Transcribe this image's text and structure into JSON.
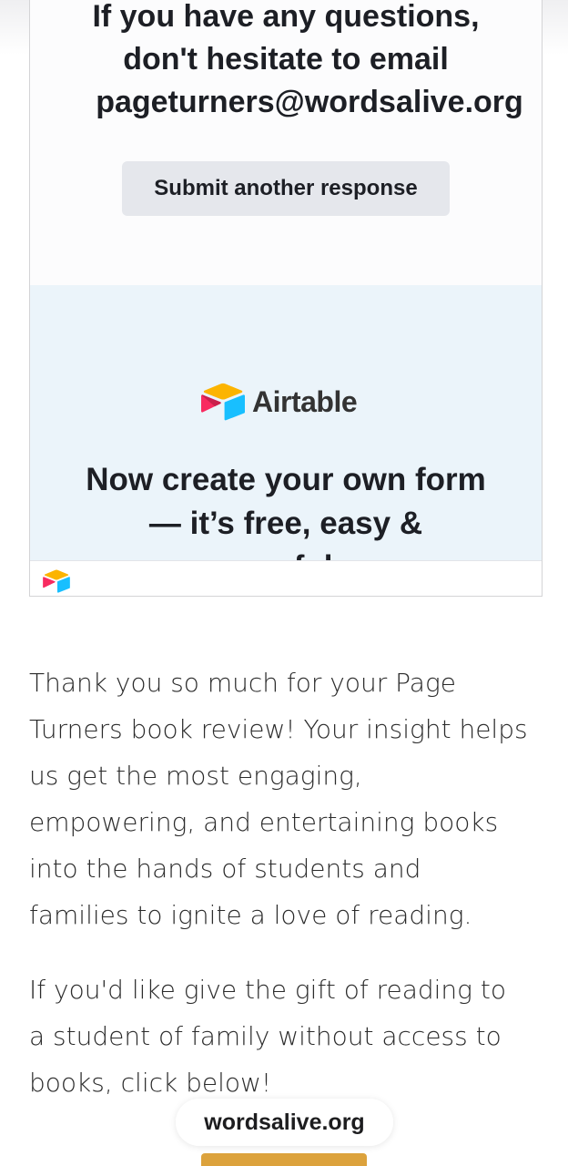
{
  "embed": {
    "confirmation_lines": [
      "If you have any questions,",
      "don't hesitate to email",
      "pageturners@wordsalive.org"
    ],
    "submit_another_label": "Submit another response",
    "promo": {
      "brand": "Airtable",
      "headline_lines": [
        "Now create your own form",
        "— it’s free, easy &",
        "useful"
      ]
    }
  },
  "content": {
    "paragraph_1_lines": [
      "Thank you so much for your Page",
      "Turners book review! Your insight helps",
      "us get the most engaging,",
      "empowering, and entertaining books",
      "into the hands of students and",
      "families to ignite a love of reading."
    ],
    "paragraph_2_lines": [
      "If you'd like give the gift of reading to",
      "a student of family without access to",
      "books, click below!"
    ]
  },
  "browser": {
    "url": "wordsalive.org"
  },
  "colors": {
    "airtable_yellow": "#FCB400",
    "airtable_blue": "#18BFFF",
    "airtable_red": "#F82B60",
    "airtable_maroon": "#BA1E45",
    "button_gold": "#DCA23C",
    "promo_background": "#EBF4FA"
  },
  "icons": {
    "brand_logo": "airtable-logo-icon",
    "footer_logo": "airtable-logo-icon"
  }
}
